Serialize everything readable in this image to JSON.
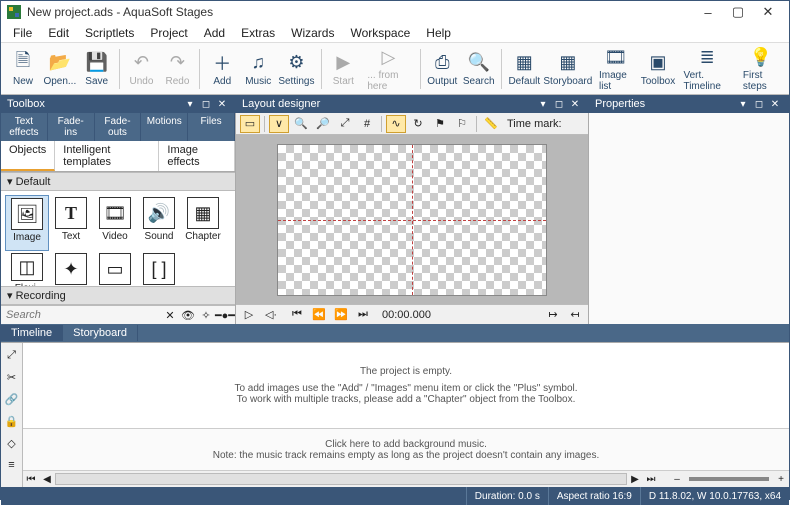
{
  "window": {
    "title": "New project.ads - AquaSoft Stages"
  },
  "menu": [
    "File",
    "Edit",
    "Scriptlets",
    "Project",
    "Add",
    "Extras",
    "Wizards",
    "Workspace",
    "Help"
  ],
  "toolbar": {
    "new": "New",
    "open": "Open...",
    "save": "Save",
    "undo": "Undo",
    "redo": "Redo",
    "add": "Add",
    "music": "Music",
    "settings": "Settings",
    "start": "Start",
    "fromhere": "... from here",
    "output": "Output",
    "search": "Search",
    "default": "Default",
    "storyboard": "Storyboard",
    "imagelist": "Image list",
    "toolbox": "Toolbox",
    "verttimeline": "Vert. Timeline",
    "firststeps": "First steps"
  },
  "panels": {
    "toolbox": "Toolbox",
    "layout": "Layout designer",
    "properties": "Properties"
  },
  "toolbox": {
    "tabs1": [
      "Text effects",
      "Fade-ins",
      "Fade-outs",
      "Motions",
      "Files"
    ],
    "tabs2": [
      "Objects",
      "Intelligent templates",
      "Image effects"
    ],
    "section_default": "Default",
    "section_recording": "Recording",
    "objects": {
      "image": "Image",
      "text": "Text",
      "video": "Video",
      "sound": "Sound",
      "chapter": "Chapter",
      "flexi": "Flexi-Coll...",
      "particle": "Particle",
      "subtitle": "Subtitle",
      "placeholder": "Placeholder"
    },
    "search_placeholder": "Search"
  },
  "designer": {
    "timemark": "Time mark:"
  },
  "playback": {
    "timecode": "00:00.000"
  },
  "timeline": {
    "tabs": [
      "Timeline",
      "Storyboard"
    ],
    "empty_title": "The project is empty.",
    "empty_line1": "To add images use the \"Add\" / \"Images\" menu item or click the \"Plus\" symbol.",
    "empty_line2": "To work with multiple tracks, please add a \"Chapter\" object from the Toolbox.",
    "music_title": "Click here to add background music.",
    "music_note": "Note: the music track remains empty as long as the project doesn't contain any images."
  },
  "status": {
    "duration": "Duration: 0.0 s",
    "aspect": "Aspect ratio 16:9",
    "version": "D 11.8.02, W 10.0.17763, x64"
  }
}
